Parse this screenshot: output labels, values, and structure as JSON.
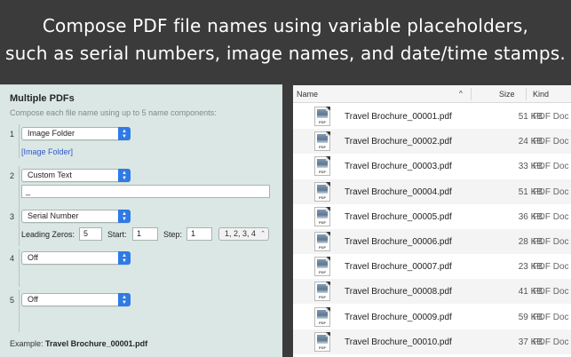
{
  "headline": {
    "line1": "Compose PDF file names using variable placeholders,",
    "line2": "such as serial numbers, image names, and date/time stamps."
  },
  "left_panel": {
    "title": "Multiple PDFs",
    "subtitle": "Compose each file name using up to 5 name components:",
    "components": [
      {
        "number": "1",
        "selected": "Image Folder",
        "token": "[Image Folder]"
      },
      {
        "number": "2",
        "selected": "Custom Text",
        "text_value": "_"
      },
      {
        "number": "3",
        "selected": "Serial Number",
        "leading_zeros_label": "Leading Zeros:",
        "leading_zeros": "5",
        "start_label": "Start:",
        "start": "1",
        "step_label": "Step:",
        "step": "1",
        "format": "1, 2, 3, 4"
      },
      {
        "number": "4",
        "selected": "Off"
      },
      {
        "number": "5",
        "selected": "Off"
      }
    ],
    "example_label": "Example:",
    "example_value": "Travel Brochure_00001.pdf"
  },
  "file_list": {
    "columns": {
      "name": "Name",
      "size": "Size",
      "kind": "Kind"
    },
    "icon_label": "PDF",
    "rows": [
      {
        "name": "Travel Brochure_00001.pdf",
        "size": "51 KB",
        "kind": "PDF Doc"
      },
      {
        "name": "Travel Brochure_00002.pdf",
        "size": "24 KB",
        "kind": "PDF Doc"
      },
      {
        "name": "Travel Brochure_00003.pdf",
        "size": "33 KB",
        "kind": "PDF Doc"
      },
      {
        "name": "Travel Brochure_00004.pdf",
        "size": "51 KB",
        "kind": "PDF Doc"
      },
      {
        "name": "Travel Brochure_00005.pdf",
        "size": "36 KB",
        "kind": "PDF Doc"
      },
      {
        "name": "Travel Brochure_00006.pdf",
        "size": "28 KB",
        "kind": "PDF Doc"
      },
      {
        "name": "Travel Brochure_00007.pdf",
        "size": "23 KB",
        "kind": "PDF Doc"
      },
      {
        "name": "Travel Brochure_00008.pdf",
        "size": "41 KB",
        "kind": "PDF Doc"
      },
      {
        "name": "Travel Brochure_00009.pdf",
        "size": "59 KB",
        "kind": "PDF Doc"
      },
      {
        "name": "Travel Brochure_00010.pdf",
        "size": "37 KB",
        "kind": "PDF Doc"
      }
    ]
  },
  "icons": {
    "select_arrow": "updown-chevron-icon",
    "sort": "sort-ascending-icon",
    "file": "pdf-file-icon"
  },
  "colors": {
    "background": "#3b3b3b",
    "panel": "#dbe7e4",
    "accent": "#2f7ae5",
    "link": "#2f59c9"
  }
}
